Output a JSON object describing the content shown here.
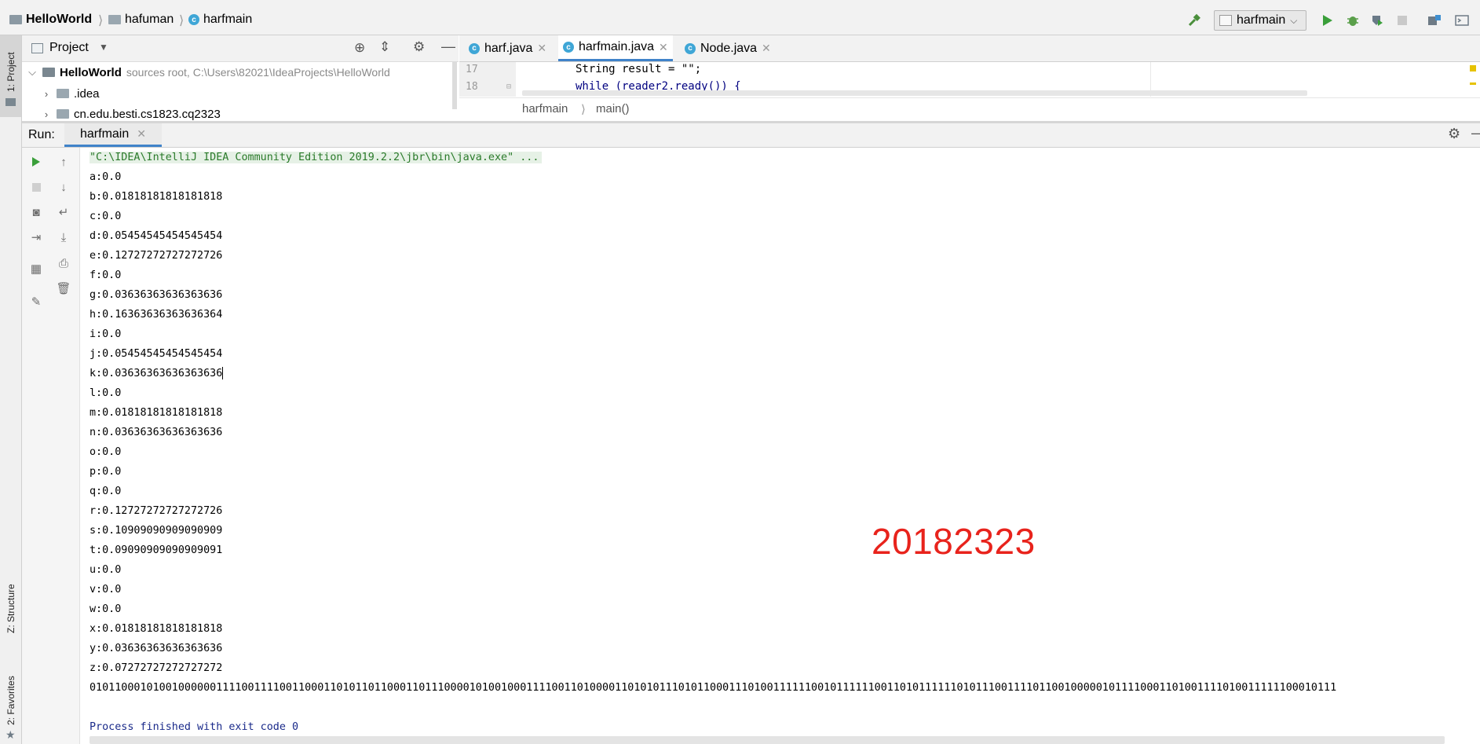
{
  "navbar": {
    "project": "HelloWorld",
    "module": "hafuman",
    "file": "harfmain",
    "run_config": "harfmain"
  },
  "left_strip": {
    "project_tab": "1: Project",
    "structure_tab": "Z: Structure",
    "favorites_tab": "2: Favorites"
  },
  "project_panel": {
    "title": "Project",
    "tree": [
      {
        "label": "HelloWorld",
        "detail": "sources root,  C:\\Users\\82021\\IdeaProjects\\HelloWorld"
      },
      {
        "label": ".idea"
      },
      {
        "label": "cn.edu.besti.cs1823.cq2323"
      }
    ]
  },
  "editor": {
    "tabs": [
      "harf.java",
      "harfmain.java",
      "Node.java"
    ],
    "active_tab": "harfmain.java",
    "lines": [
      {
        "num": "17",
        "code": "String result = \"\";"
      },
      {
        "num": "18",
        "code": "while (reader2.ready()) {"
      }
    ],
    "breadcrumb": [
      "harfmain",
      "main()"
    ]
  },
  "run_panel": {
    "label": "Run:",
    "tab": "harfmain"
  },
  "console": {
    "command": "\"C:\\IDEA\\IntelliJ IDEA Community Edition 2019.2.2\\jbr\\bin\\java.exe\" ...",
    "lines": [
      "a:0.0",
      "b:0.01818181818181818",
      "c:0.0",
      "d:0.05454545454545454",
      "e:0.12727272727272726",
      "f:0.0",
      "g:0.03636363636363636",
      "h:0.16363636363636364",
      "i:0.0",
      "j:0.05454545454545454",
      "k:0.03636363636363636",
      "l:0.0",
      "m:0.01818181818181818",
      "n:0.03636363636363636",
      "o:0.0",
      "p:0.0",
      "q:0.0",
      "r:0.12727272727272726",
      "s:0.10909090909090909",
      "t:0.09090909090909091",
      "u:0.0",
      "v:0.0",
      "w:0.0",
      "x:0.01818181818181818",
      "y:0.03636363636363636",
      "z:0.07272727272727272",
      "01011000101001000000111100111100110001101011011000110111000010100100011110011010000110101011101011000111010011111100101111110011010111111010111001111011001000001011110001101001111010011111100010111"
    ],
    "exit": "Process finished with exit code 0"
  },
  "watermark": "20182323",
  "colors": {
    "accent": "#4083c9",
    "watermark": "#e8231c",
    "run_green": "#3a9f3a"
  }
}
